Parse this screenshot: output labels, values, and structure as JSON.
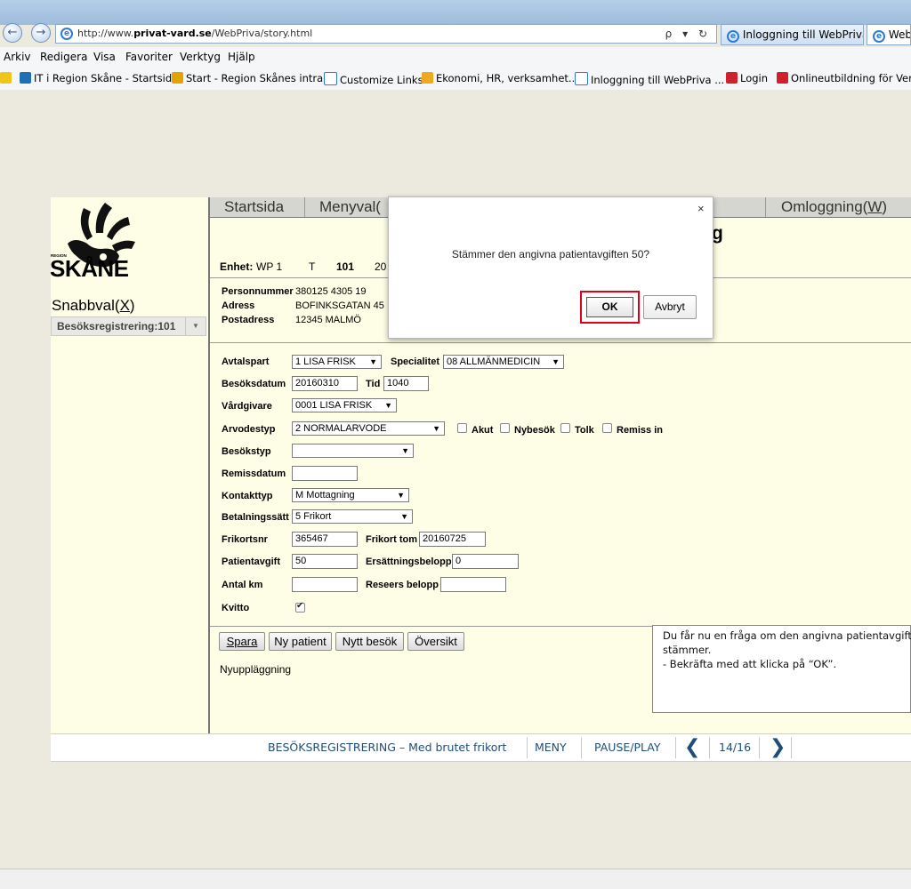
{
  "browser": {
    "url_prefix": "http://www.",
    "url_domain": "privat-vard.se",
    "url_path": "/WebPriva/story.html",
    "addr_tools": "ρ ▾ ↻",
    "tabs": [
      "Inloggning till WebPriva ...",
      "WebP"
    ],
    "menu": [
      "Arkiv",
      "Redigera",
      "Visa",
      "Favoriter",
      "Verktyg",
      "Hjälp"
    ],
    "favorites": [
      "IT i Region Skåne - Startsida",
      "Start - Region Skånes intra...",
      "Customize Links",
      "Ekonomi, HR, verksamhet...",
      "Inloggning till WebPriva ...",
      "Login",
      "Onlineutbildning för Verk"
    ]
  },
  "logo": {
    "small": "REGION",
    "big": "SKÅNE"
  },
  "sidebar": {
    "snabbval_prefix": "Snabbval(",
    "snabbval_key": "X",
    "snabbval_suffix": ")",
    "selected": "Besöksregistrering:101"
  },
  "topmenu": {
    "startsida": "Startsida",
    "menyval": "Menyval(",
    "omloggning_prefix": "Omloggning(",
    "omloggning_key": "W",
    "omloggning_suffix": ")"
  },
  "header": {
    "enhet_label": "Enhet:",
    "enhet_value": "WP 1",
    "t_label": "T",
    "t_value": "101",
    "extra": "20",
    "pnr_label": "Personnummer",
    "pnr_value": "380125 4305  19",
    "adress_label": "Adress",
    "adress_value": "BOFINKSGATAN 45",
    "post_label": "Postadress",
    "post_value": "12345    MALMÖ",
    "hidden_title_char": "g"
  },
  "form": {
    "avtalspart_label": "Avtalspart",
    "avtalspart": "1 LISA FRISK",
    "specialitet_label": "Specialitet",
    "specialitet": "08 ALLMÄNMEDICIN",
    "besoksdatum_label": "Besöksdatum",
    "besoksdatum": "20160310",
    "tid_label": "Tid",
    "tid": "1040",
    "vardgivare_label": "Vårdgivare",
    "vardgivare": "0001 LISA FRISK",
    "arvodestyp_label": "Arvodestyp",
    "arvodestyp": "2 NORMALARVODE",
    "akut": "Akut",
    "nybesok": "Nybesök",
    "tolk": "Tolk",
    "remiss": "Remiss in",
    "besokstyp_label": "Besökstyp",
    "besokstyp": "",
    "remissdatum_label": "Remissdatum",
    "remissdatum": "",
    "kontakttyp_label": "Kontakttyp",
    "kontakttyp": "M Mottagning",
    "betalningssatt_label": "Betalningssätt",
    "betalningssatt": "5 Frikort",
    "frikortsnr_label": "Frikortsnr",
    "frikortsnr": "365467",
    "frikort_tom_label": "Frikort tom",
    "frikort_tom": "20160725",
    "patientavgift_label": "Patientavgift",
    "patientavgift": "50",
    "ersattning_label": "Ersättningsbelopp",
    "ersattning": "0",
    "antal_km_label": "Antal km",
    "antal_km": "",
    "reseers_label": "Reseers belopp",
    "reseers": "",
    "kvitto_label": "Kvitto",
    "kvitto_checked": true
  },
  "buttons": {
    "spara": "Spara",
    "ny_patient": "Ny patient",
    "nytt_besok": "Nytt besök",
    "oversikt": "Översikt"
  },
  "status_text": "Nyuppläggning",
  "dialog": {
    "close": "×",
    "message": "Stämmer den angivna patientavgiften 50?",
    "ok": "OK",
    "cancel": "Avbryt"
  },
  "callout": {
    "line1": "Du får nu en fråga om den angivna patientavgifte",
    "line2": "stämmer.",
    "line3": "- Bekräfta med att klicka på “OK”."
  },
  "footer": {
    "title": "BESÖKSREGISTRERING – Med brutet frikort",
    "menu": "MENY",
    "pause": "PAUSE/PLAY",
    "prev": "❮",
    "progress": "14/16",
    "next": "❯"
  },
  "colors": {
    "accent": "#1e4d7a",
    "highlight": "#e0001b",
    "app_bg": "#fefee6"
  }
}
